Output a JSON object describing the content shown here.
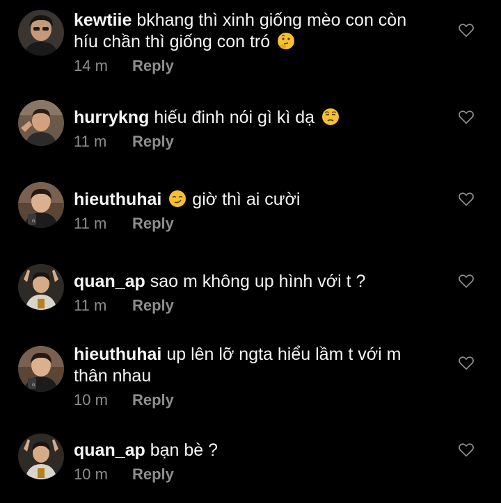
{
  "colors": {
    "background": "#000000",
    "text": "#f5f5f5",
    "secondary": "#8e8e8e",
    "emoji_face": "#f6c02e"
  },
  "comments": [
    {
      "username": "kewtiie",
      "text_1": "bkhang thì xinh giống mèo con còn",
      "text_2": "híu chần thì giống con tró",
      "emoji": "thinking-face-emoji",
      "time": "14 m",
      "reply": "Reply"
    },
    {
      "username": "hurrykng",
      "text_1": "hiếu đinh nói gì kì dạ",
      "emoji": "unamused-face-emoji",
      "time": "11 m",
      "reply": "Reply"
    },
    {
      "username": "hieuthuhai",
      "emoji": "smirking-face-emoji",
      "text_1": "giờ thì ai cười",
      "time": "11 m",
      "reply": "Reply"
    },
    {
      "username": "quan_ap",
      "text_1": "sao m không up hình với t ?",
      "time": "11 m",
      "reply": "Reply"
    },
    {
      "username": "hieuthuhai",
      "text_1": "up lên lỡ ngta hiểu lầm t với m",
      "text_2": "thân nhau",
      "time": "10 m",
      "reply": "Reply"
    },
    {
      "username": "quan_ap",
      "text_1": "bạn bè ?",
      "time": "10 m",
      "reply": "Reply"
    }
  ]
}
